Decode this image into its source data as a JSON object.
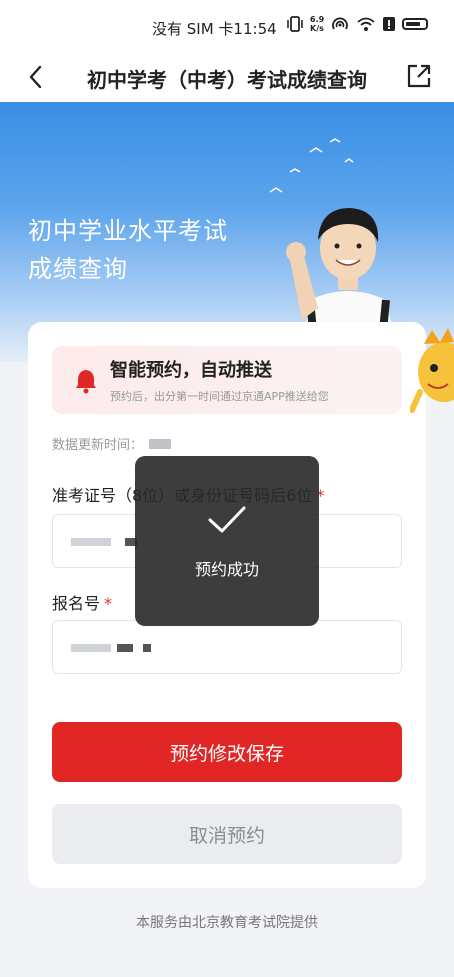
{
  "status_bar": {
    "carrier_time": "没有 SIM 卡11:54",
    "net_speed_value": "6.9",
    "net_speed_unit": "K/s"
  },
  "nav": {
    "title": "初中学考（中考）考试成绩查询",
    "back_icon": "chevron-left-icon",
    "share_icon": "share-external-icon"
  },
  "hero": {
    "title_line1": "初中学业水平考试",
    "title_line2": "成绩查询"
  },
  "notice": {
    "title": "智能预约，自动推送",
    "subtitle": "预约后，出分第一时间通过京通APP推送给您"
  },
  "form": {
    "update_label": "数据更新时间：",
    "field1_label": "准考证号（8位）或身份证号码后6位",
    "field2_label": "报名号",
    "required_mark": "*"
  },
  "buttons": {
    "save": "预约修改保存",
    "cancel": "取消预约"
  },
  "toast": {
    "message": "预约成功"
  },
  "footer": {
    "text": "本服务由北京教育考试院提供"
  },
  "colors": {
    "primary_red": "#e12626",
    "required_red": "#e02f2f",
    "hero_blue": "#3a8ee6"
  }
}
